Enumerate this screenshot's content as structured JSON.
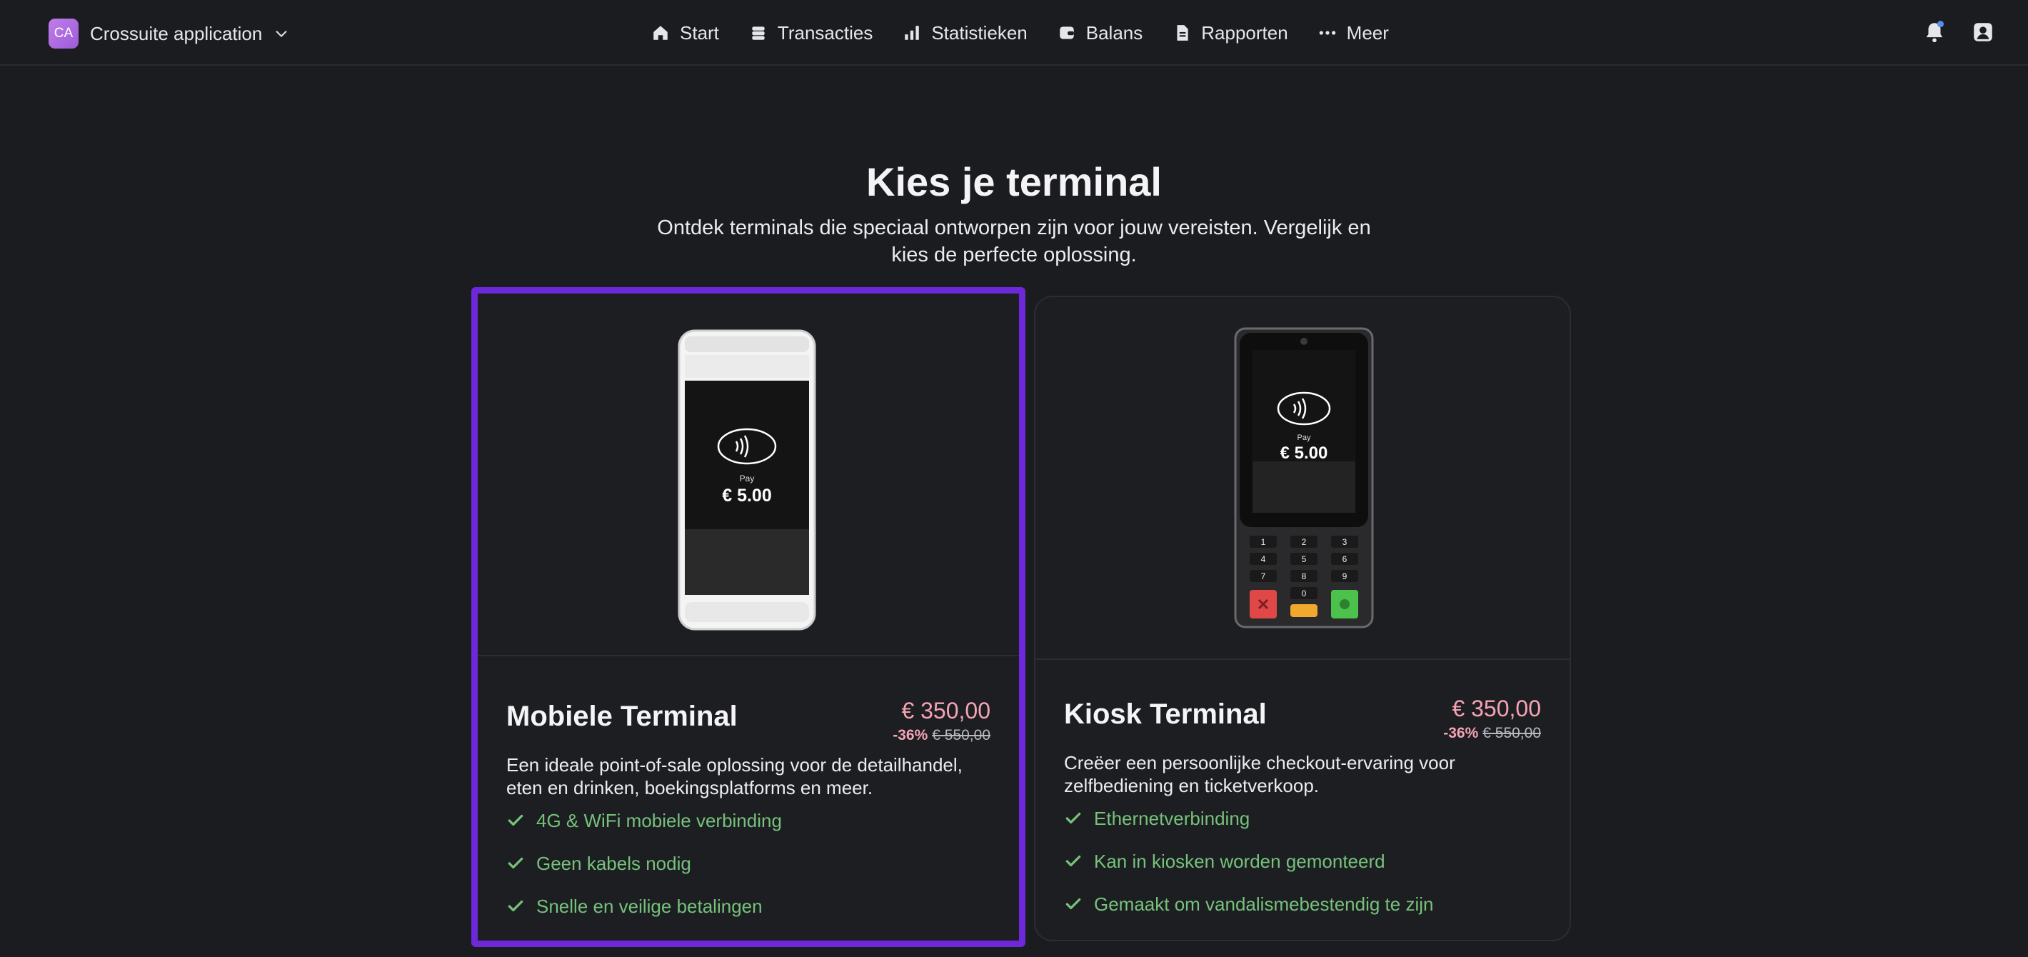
{
  "header": {
    "app_initials": "CA",
    "app_name": "Crossuite application",
    "nav": [
      {
        "label": "Start",
        "icon": "home-icon"
      },
      {
        "label": "Transacties",
        "icon": "stack-icon"
      },
      {
        "label": "Statistieken",
        "icon": "bar-chart-icon"
      },
      {
        "label": "Balans",
        "icon": "wallet-icon"
      },
      {
        "label": "Rapporten",
        "icon": "document-icon"
      },
      {
        "label": "Meer",
        "icon": "more-icon"
      }
    ]
  },
  "hero": {
    "title": "Kies je terminal",
    "subtitle": "Ontdek terminals die speciaal ontworpen zijn voor jouw vereisten. Vergelijk en kies de perfecte oplossing."
  },
  "cards": [
    {
      "title": "Mobiele Terminal",
      "price": "€ 350,00",
      "discount": "-36%",
      "old_price": "€ 550,00",
      "description": "Een ideale point-of-sale oplossing voor de detailhandel, eten en drinken, boekingsplatforms en meer.",
      "features": [
        "4G & WiFi mobiele verbinding",
        "Geen kabels nodig",
        "Snelle en veilige betalingen"
      ],
      "screen_label": "Pay",
      "screen_amount": "€ 5.00",
      "selected": true
    },
    {
      "title": "Kiosk Terminal",
      "price": "€ 350,00",
      "discount": "-36%",
      "old_price": "€ 550,00",
      "description": "Creëer een persoonlijke checkout-ervaring voor zelfbediening en ticketverkoop.",
      "features": [
        "Ethernetverbinding",
        "Kan in kiosken worden gemonteerd",
        "Gemaakt om vandalismebestendig te zijn"
      ],
      "screen_label": "Pay",
      "screen_amount": "€ 5.00",
      "keypad": [
        "1",
        "2",
        "3",
        "4",
        "5",
        "6",
        "7",
        "8",
        "9",
        "0"
      ],
      "selected": false
    }
  ],
  "colors": {
    "background": "#1b1c20",
    "accent_selected": "#6d28d9",
    "price": "#f5a3b4",
    "feature_check": "#76c27b",
    "notification_dot": "#5b8def"
  }
}
